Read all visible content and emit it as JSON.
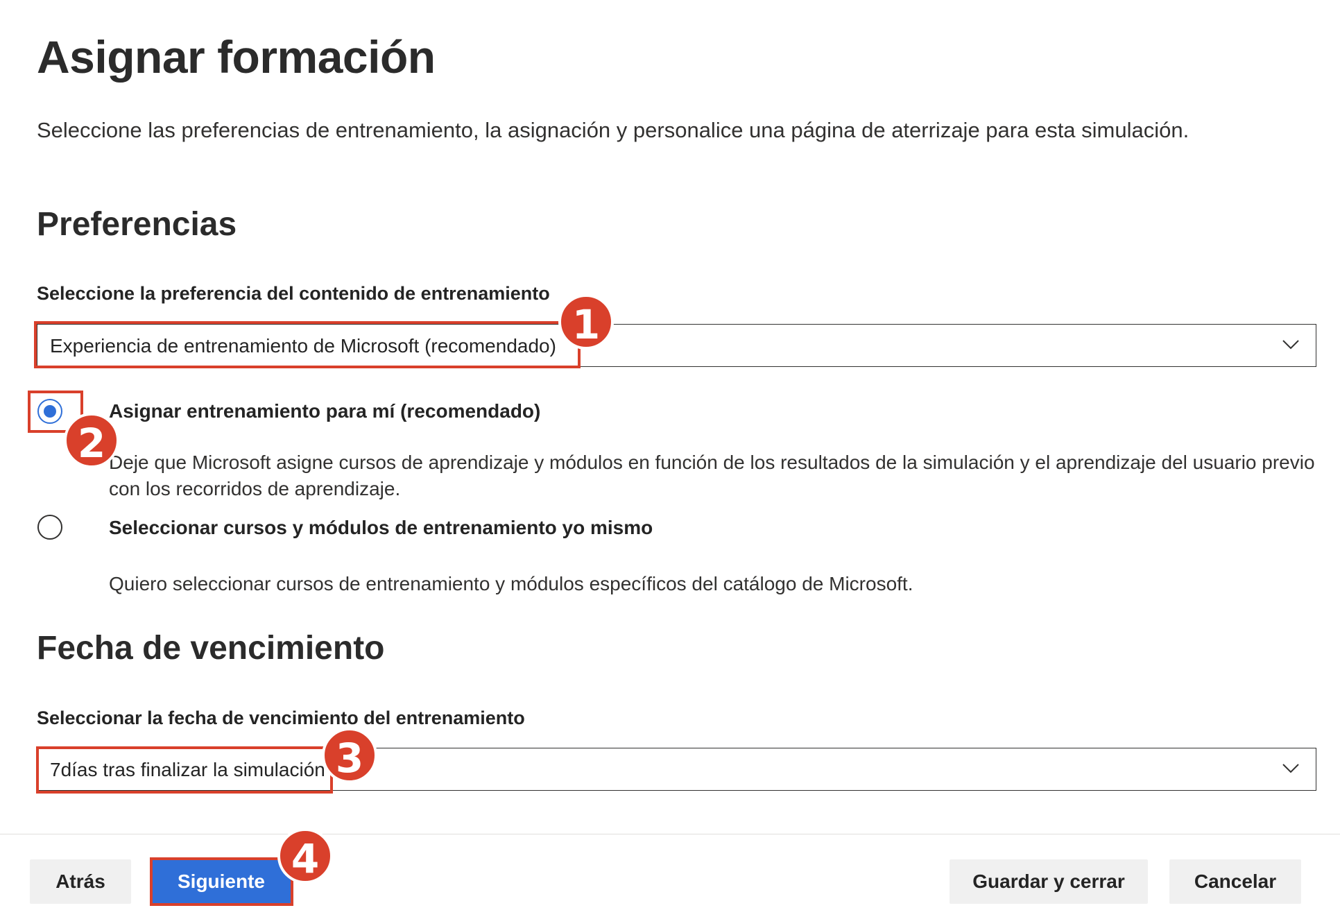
{
  "page": {
    "title": "Asignar formación",
    "description": "Seleccione las preferencias de entrenamiento, la asignación y personalice una página de aterrizaje para esta simulación."
  },
  "preferences": {
    "section_title": "Preferencias",
    "content_label": "Seleccione la preferencia del contenido de entrenamiento",
    "content_value": "Experiencia de entrenamiento de Microsoft (recomendado)",
    "options": [
      {
        "title": "Asignar entrenamiento para mí (recomendado)",
        "description": "Deje que Microsoft asigne cursos de aprendizaje y módulos en función de los resultados de la simulación y el aprendizaje del usuario previo con los recorridos de aprendizaje.",
        "selected": true
      },
      {
        "title": "Seleccionar cursos y módulos de entrenamiento yo mismo",
        "description": "Quiero seleccionar cursos de entrenamiento y módulos específicos del catálogo de Microsoft.",
        "selected": false
      }
    ]
  },
  "due_date": {
    "section_title": "Fecha de vencimiento",
    "label": "Seleccionar la fecha de vencimiento del entrenamiento",
    "value": "7días tras finalizar la simulación"
  },
  "footer": {
    "back_label": "Atrás",
    "next_label": "Siguiente",
    "save_close_label": "Guardar y cerrar",
    "cancel_label": "Cancelar"
  },
  "callouts": [
    "1",
    "2",
    "3",
    "4"
  ],
  "colors": {
    "accent": "#2f6fd8",
    "callout": "#d9402b",
    "secondary_button": "#f0f0f0"
  },
  "icons": {
    "dropdown": "chevron-down-icon"
  }
}
